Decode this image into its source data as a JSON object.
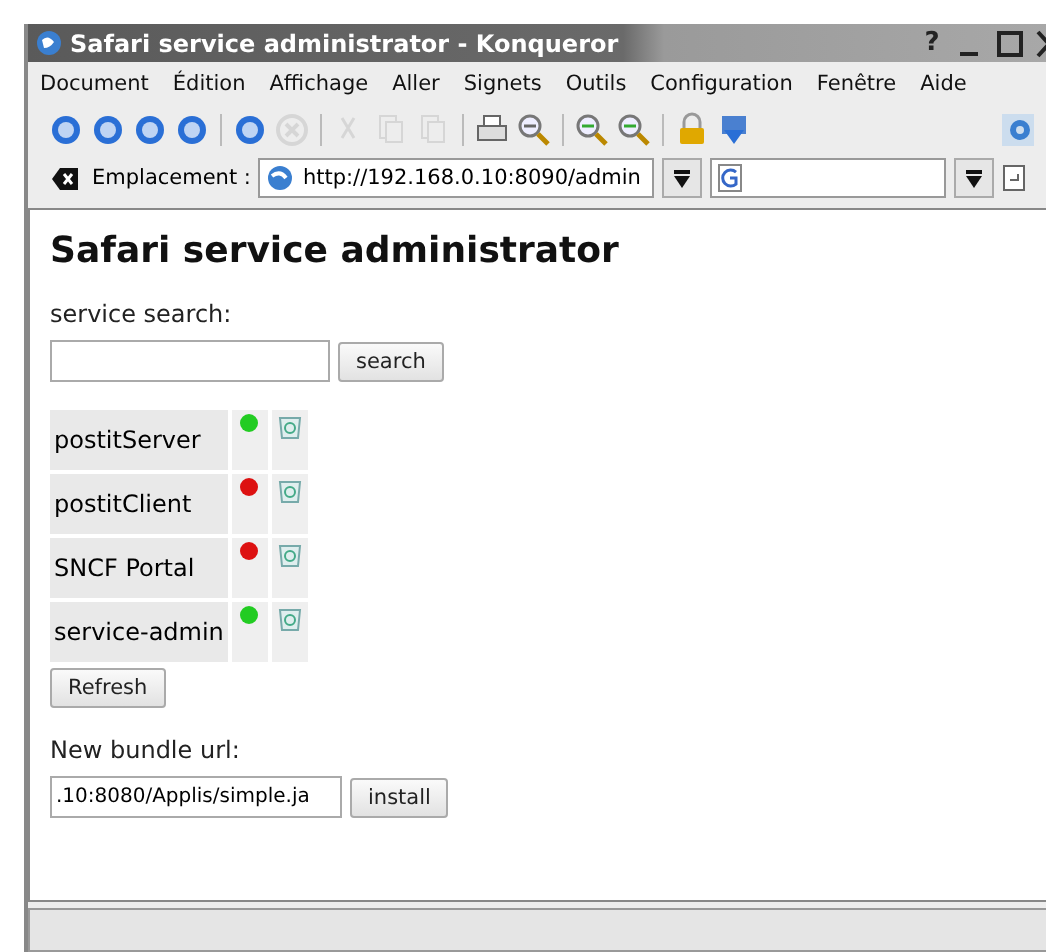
{
  "window": {
    "title": "Safari service administrator - Konqueror",
    "help": "?"
  },
  "menu": [
    {
      "label": "Document"
    },
    {
      "label": "Édition"
    },
    {
      "label": "Affichage"
    },
    {
      "label": "Aller"
    },
    {
      "label": "Signets"
    },
    {
      "label": "Outils"
    },
    {
      "label": "Configuration"
    },
    {
      "label": "Fenêtre"
    },
    {
      "label": "Aide"
    }
  ],
  "toolbar": [
    {
      "kind": "up",
      "disabled": false
    },
    {
      "kind": "back",
      "disabled": false
    },
    {
      "kind": "forward",
      "disabled": false
    },
    {
      "kind": "home",
      "disabled": false
    },
    {
      "kind": "sep"
    },
    {
      "kind": "reload",
      "disabled": false
    },
    {
      "kind": "stop",
      "disabled": true
    },
    {
      "kind": "sep"
    },
    {
      "kind": "cut",
      "disabled": true
    },
    {
      "kind": "copy",
      "disabled": true
    },
    {
      "kind": "paste",
      "disabled": true
    },
    {
      "kind": "sep"
    },
    {
      "kind": "print",
      "disabled": false
    },
    {
      "kind": "find",
      "disabled": false
    },
    {
      "kind": "sep"
    },
    {
      "kind": "zoomin",
      "disabled": false
    },
    {
      "kind": "zoomout",
      "disabled": false
    },
    {
      "kind": "sep"
    },
    {
      "kind": "lock",
      "disabled": false
    },
    {
      "kind": "download",
      "disabled": false
    }
  ],
  "location": {
    "label": "Emplacement :",
    "url": "http://192.168.0.10:8090/admin"
  },
  "page": {
    "heading": "Safari service administrator",
    "search_label": "service search:",
    "search_button": "search",
    "services": [
      {
        "name": "postitServer",
        "color": "#22cc22"
      },
      {
        "name": "postitClient",
        "color": "#dd1111"
      },
      {
        "name": "SNCF Portal",
        "color": "#dd1111"
      },
      {
        "name": "service-admin",
        "color": "#22cc22"
      }
    ],
    "refresh_button": "Refresh",
    "bundle_label": "New bundle url:",
    "bundle_url": ".10:8080/Applis/simple.ja",
    "install_button": "install"
  }
}
